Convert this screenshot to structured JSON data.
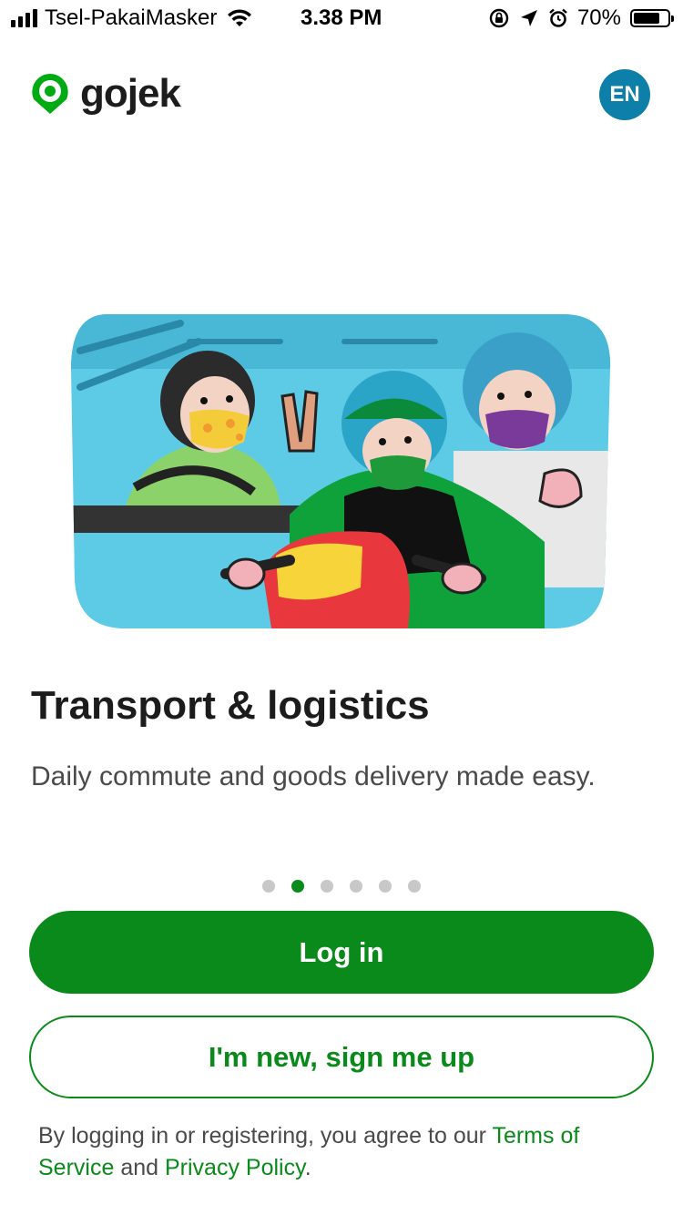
{
  "status_bar": {
    "carrier": "Tsel-PakaiMasker",
    "time": "3.38 PM",
    "battery": "70%",
    "icons": [
      "signal-bars-icon",
      "wifi-icon",
      "orientation-lock-icon",
      "location-arrow-icon",
      "alarm-icon",
      "battery-icon"
    ]
  },
  "header": {
    "brand": "gojek",
    "language_label": "EN",
    "brand_color": "#00AA13",
    "language_button_color": "#0E7FA8"
  },
  "onboarding": {
    "title": "Transport & logistics",
    "subtitle": "Daily commute and goods delivery made easy.",
    "page_count": 6,
    "active_page": 2
  },
  "actions": {
    "login_label": "Log in",
    "signup_label": "I'm new, sign me up",
    "primary_color": "#0A8A1A"
  },
  "legal": {
    "prefix": "By logging in or registering, you agree to our ",
    "terms_label": "Terms of Service",
    "middle": " and ",
    "privacy_label": "Privacy Policy",
    "suffix": "."
  }
}
